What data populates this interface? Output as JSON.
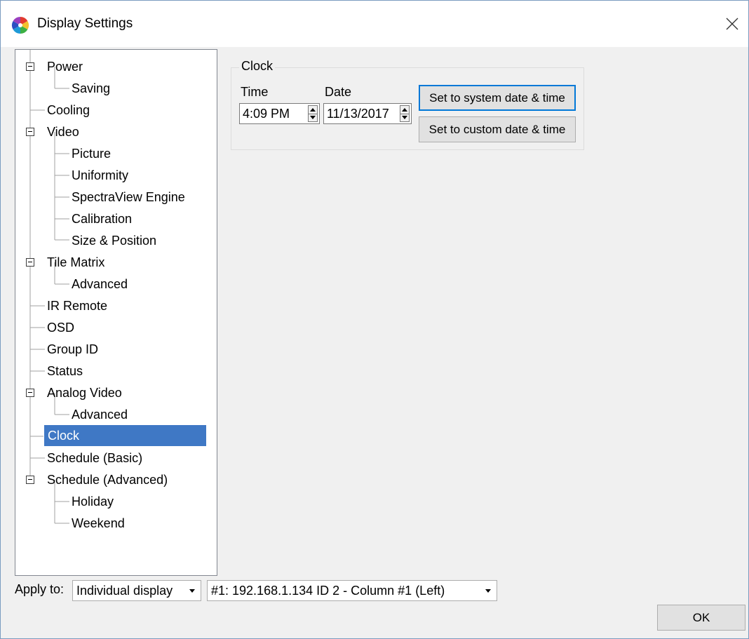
{
  "window": {
    "title": "Display Settings",
    "close_glyph": "✕"
  },
  "tree": {
    "items": [
      {
        "label": "Power",
        "level": 0,
        "expandable": true
      },
      {
        "label": "Saving",
        "level": 1
      },
      {
        "label": "Cooling",
        "level": 0
      },
      {
        "label": "Video",
        "level": 0,
        "expandable": true
      },
      {
        "label": "Picture",
        "level": 1
      },
      {
        "label": "Uniformity",
        "level": 1
      },
      {
        "label": "SpectraView Engine",
        "level": 1
      },
      {
        "label": "Calibration",
        "level": 1
      },
      {
        "label": "Size & Position",
        "level": 1
      },
      {
        "label": "Tile Matrix",
        "level": 0,
        "expandable": true
      },
      {
        "label": "Advanced",
        "level": 1
      },
      {
        "label": "IR Remote",
        "level": 0
      },
      {
        "label": "OSD",
        "level": 0
      },
      {
        "label": "Group ID",
        "level": 0
      },
      {
        "label": "Status",
        "level": 0
      },
      {
        "label": "Analog Video",
        "level": 0,
        "expandable": true
      },
      {
        "label": "Advanced",
        "level": 1
      },
      {
        "label": "Clock",
        "level": 0,
        "selected": true
      },
      {
        "label": "Schedule (Basic)",
        "level": 0
      },
      {
        "label": "Schedule (Advanced)",
        "level": 0,
        "expandable": true
      },
      {
        "label": "Holiday",
        "level": 1
      },
      {
        "label": "Weekend",
        "level": 1
      }
    ]
  },
  "clock": {
    "group_title": "Clock",
    "time_label": "Time",
    "time_value": "4:09 PM",
    "date_label": "Date",
    "date_value": "11/13/2017",
    "set_system_label": "Set to system date & time",
    "set_custom_label": "Set to custom date & time"
  },
  "footer": {
    "apply_label": "Apply to:",
    "apply_mode": "Individual display",
    "display_target": "#1: 192.168.1.134 ID 2 - Column #1 (Left)",
    "ok_label": "OK"
  },
  "colors": {
    "selection": "#3f78c5",
    "default_border": "#0078d7"
  }
}
